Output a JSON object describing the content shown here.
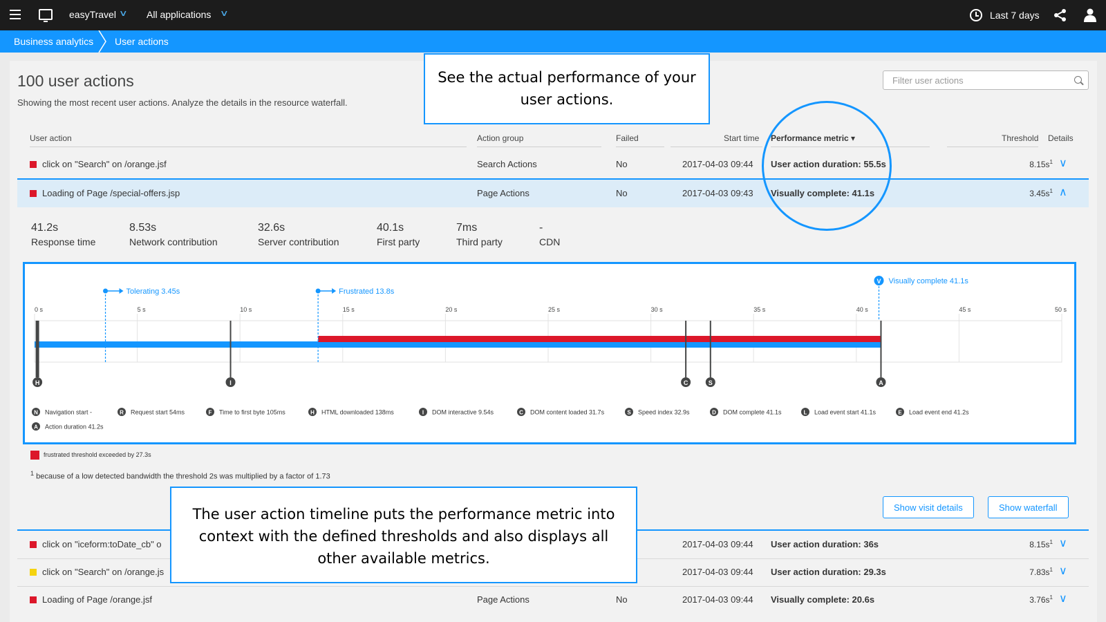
{
  "topbar": {
    "menu_icon": "hamburger-icon",
    "environment": "easyTravel",
    "applications": "All applications",
    "timeframe": "Last 7 days",
    "share_icon": "share-icon",
    "user_icon": "user-icon"
  },
  "breadcrumb": {
    "items": [
      "Business analytics",
      "User actions"
    ]
  },
  "page": {
    "title": "100 user actions",
    "subtitle": "Showing the most recent user actions. Analyze the details in the resource waterfall.",
    "filter_placeholder": "Filter user actions"
  },
  "table": {
    "headers": {
      "user_action": "User action",
      "action_group": "Action group",
      "failed": "Failed",
      "start_time": "Start time",
      "performance_metric": "Performance metric ▾",
      "threshold": "Threshold",
      "details": "Details"
    },
    "rows": [
      {
        "color": "#dc172a",
        "name": "click on \"Search\" on /orange.jsf",
        "group": "Search Actions",
        "failed": "No",
        "start": "2017-04-03 09:44",
        "metric": "User action duration: 55.5s",
        "threshold": "8.15s",
        "sup": "1",
        "expanded": false
      },
      {
        "color": "#dc172a",
        "name": "Loading of Page /special-offers.jsp",
        "group": "Page Actions",
        "failed": "No",
        "start": "2017-04-03 09:43",
        "metric": "Visually complete: 41.1s",
        "threshold": "3.45s",
        "sup": "1",
        "expanded": true
      },
      {
        "color": "#dc172a",
        "name": "click on \"iceform:toDate_cb\" o",
        "group": "",
        "failed": "",
        "start": "2017-04-03 09:44",
        "metric": "User action duration: 36s",
        "threshold": "8.15s",
        "sup": "1",
        "expanded": false
      },
      {
        "color": "#f5d30f",
        "name": "click on \"Search\" on /orange.js",
        "group": "",
        "failed": "",
        "start": "2017-04-03 09:44",
        "metric": "User action duration: 29.3s",
        "threshold": "7.83s",
        "sup": "1",
        "expanded": false
      },
      {
        "color": "#dc172a",
        "name": "Loading of Page /orange.jsf",
        "group": "Page Actions",
        "failed": "No",
        "start": "2017-04-03 09:44",
        "metric": "Visually complete: 20.6s",
        "threshold": "3.76s",
        "sup": "1",
        "expanded": false
      }
    ]
  },
  "kpis": [
    {
      "value": "41.2s",
      "label": "Response time"
    },
    {
      "value": "8.53s",
      "label": "Network contribution"
    },
    {
      "value": "32.6s",
      "label": "Server contribution"
    },
    {
      "value": "40.1s",
      "label": "First party"
    },
    {
      "value": "7ms",
      "label": "Third party"
    },
    {
      "value": "-",
      "label": "CDN"
    }
  ],
  "timeline": {
    "ticks": [
      "0 s",
      "5 s",
      "10 s",
      "15 s",
      "20 s",
      "25 s",
      "30 s",
      "35 s",
      "40 s",
      "45 s",
      "50 s"
    ],
    "tick_values": [
      0,
      5,
      10,
      15,
      20,
      25,
      30,
      35,
      40,
      45,
      50
    ],
    "x_max": 50,
    "tolerating": {
      "label": "Tolerating 3.45s",
      "value": 3.45
    },
    "frustrated": {
      "label": "Frustrated 13.8s",
      "value": 13.8
    },
    "visually_complete": {
      "label": "Visually complete 41.1s",
      "value": 41.1
    },
    "bars": {
      "blue_end": 41.2,
      "red_start": 13.8,
      "red_end": 41.2
    },
    "markers": [
      {
        "letter": "H",
        "value": 0.138
      },
      {
        "letter": "I",
        "value": 9.54
      },
      {
        "letter": "C",
        "value": 31.7
      },
      {
        "letter": "S",
        "value": 32.9
      },
      {
        "letter": "A",
        "value": 41.2
      }
    ],
    "legend": [
      {
        "letter": "N",
        "text": "Navigation start -"
      },
      {
        "letter": "R",
        "text": "Request start 54ms"
      },
      {
        "letter": "F",
        "text": "Time to first byte 105ms"
      },
      {
        "letter": "H",
        "text": "HTML downloaded 138ms"
      },
      {
        "letter": "I",
        "text": "DOM interactive 9.54s"
      },
      {
        "letter": "C",
        "text": "DOM content loaded 31.7s"
      },
      {
        "letter": "S",
        "text": "Speed index 32.9s"
      },
      {
        "letter": "D",
        "text": "DOM complete 41.1s"
      },
      {
        "letter": "L",
        "text": "Load event start 41.1s"
      },
      {
        "letter": "E",
        "text": "Load event end 41.2s"
      },
      {
        "letter": "A",
        "text": "Action duration 41.2s"
      }
    ],
    "colors": {
      "blue": "#1496ff",
      "red": "#dc172a",
      "marker": "#454646"
    }
  },
  "legend_frustrated": "frustrated threshold exceeded by 27.3s",
  "footnote": {
    "sup": "1",
    "text": " because of a low detected bandwidth the threshold 2s was multiplied by a factor of 1.73"
  },
  "buttons": {
    "visit": "Show visit details",
    "waterfall": "Show waterfall"
  },
  "callouts": {
    "top": "See the actual performance of your user actions.",
    "bottom": "The user action timeline puts the performance metric into context with the defined thresholds and also displays all other available metrics."
  }
}
